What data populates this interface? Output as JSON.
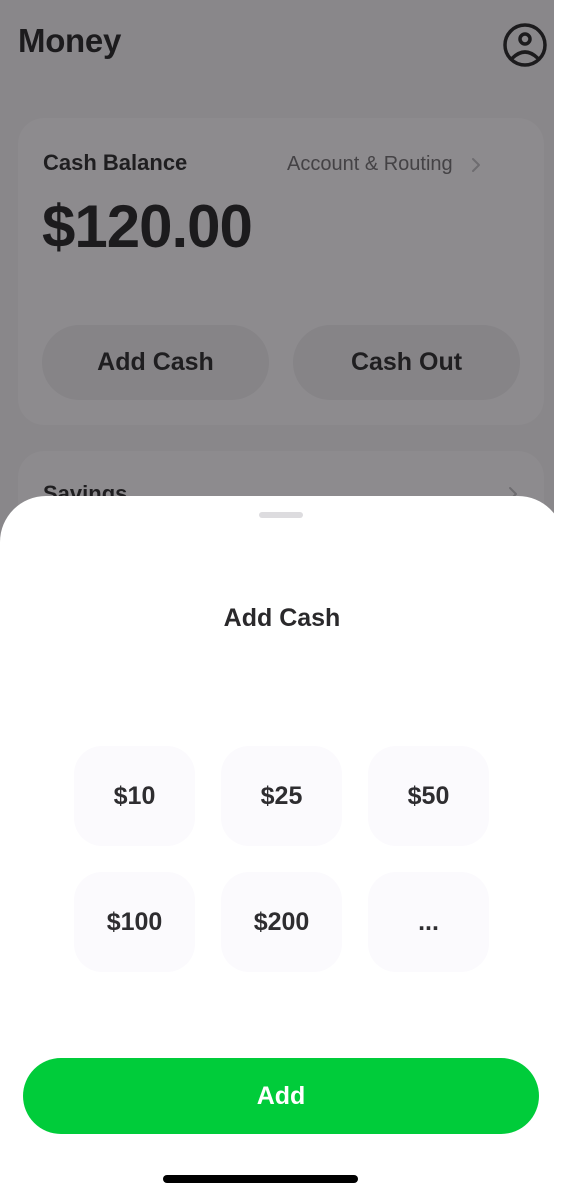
{
  "header": {
    "title": "Money",
    "profile_icon": "person-circle-icon"
  },
  "balance_card": {
    "label": "Cash Balance",
    "account_link": "Account & Routing",
    "amount": "$120.00",
    "add_cash_label": "Add Cash",
    "cash_out_label": "Cash Out"
  },
  "savings_card": {
    "label": "Savings"
  },
  "sheet": {
    "title": "Add Cash",
    "amounts": [
      "$10",
      "$25",
      "$50",
      "$100",
      "$200",
      "..."
    ],
    "add_label": "Add"
  },
  "colors": {
    "accent_green": "#00cc3a",
    "overlay_gray": "#89878a"
  }
}
